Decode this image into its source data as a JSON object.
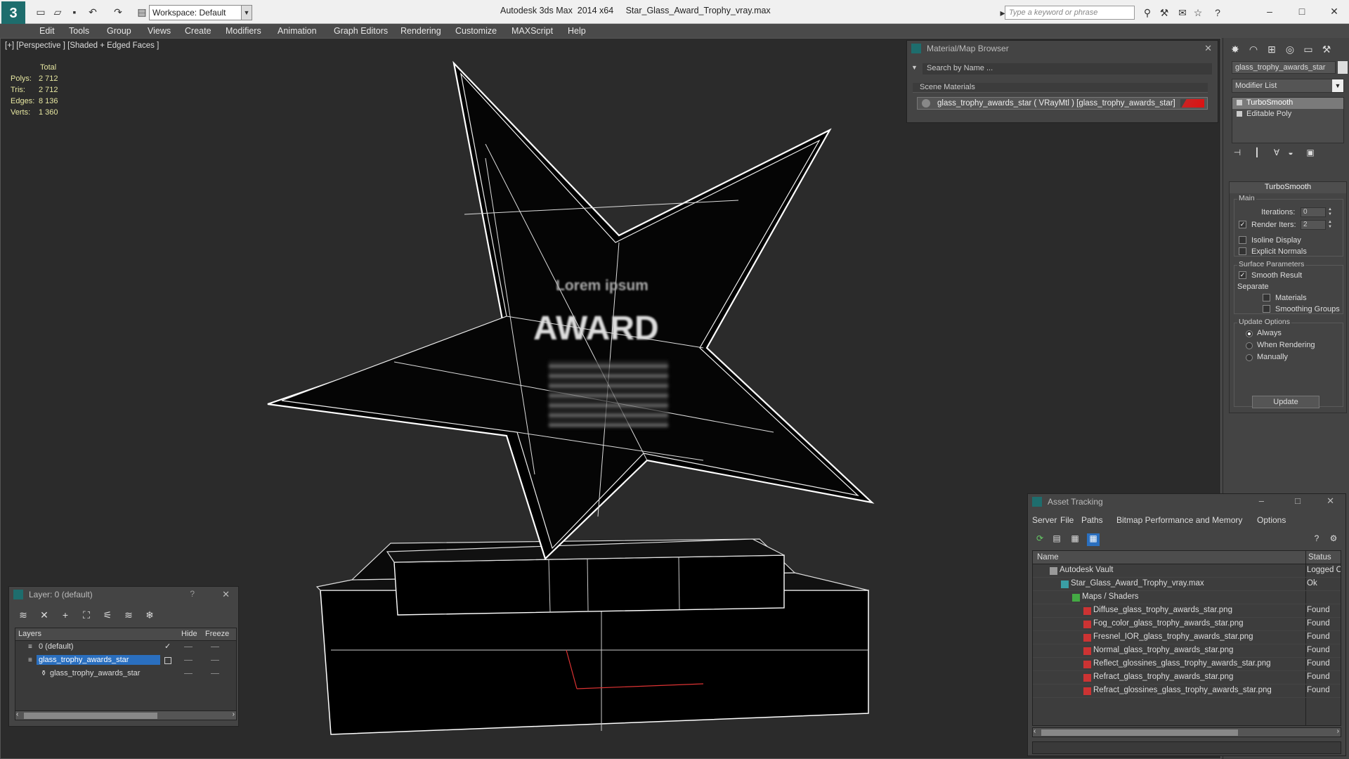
{
  "titlebar": {
    "workspace": "Workspace: Default",
    "title": "Autodesk 3ds Max  2014 x64     Star_Glass_Award_Trophy_vray.max",
    "search_placeholder": "Type a keyword or phrase"
  },
  "menu": [
    "Edit",
    "Tools",
    "Group",
    "Views",
    "Create",
    "Modifiers",
    "Animation",
    "Graph Editors",
    "Rendering",
    "Customize",
    "MAXScript",
    "Help"
  ],
  "viewport": {
    "label": "[+] [Perspective ] [Shaded + Edged Faces ]",
    "stats_header": "Total",
    "stats": [
      {
        "label": "Polys:",
        "value": "2 712"
      },
      {
        "label": "Tris:",
        "value": "2 712"
      },
      {
        "label": "Edges:",
        "value": "8 136"
      },
      {
        "label": "Verts:",
        "value": "1 360"
      }
    ],
    "award_top": "Lorem ipsum",
    "award_main": "AWARD"
  },
  "material_browser": {
    "title": "Material/Map Browser",
    "search": "Search by Name ...",
    "group": "Scene Materials",
    "entry": "glass_trophy_awards_star ( VRayMtl ) [glass_trophy_awards_star]",
    "swatch_color": "#cc1111"
  },
  "command_panel": {
    "object_name": "glass_trophy_awards_star",
    "modifier_list": "Modifier List",
    "stack": [
      "TurboSmooth",
      "Editable Poly"
    ],
    "rollout_title": "TurboSmooth",
    "main_group": "Main",
    "iterations_label": "Iterations:",
    "iterations_value": "0",
    "render_iters_label": "Render Iters:",
    "render_iters_value": "2",
    "isoline": "Isoline Display",
    "explicit_normals": "Explicit Normals",
    "surface_group": "Surface Parameters",
    "smooth_result": "Smooth Result",
    "separate": "Separate",
    "materials": "Materials",
    "smoothing_groups": "Smoothing Groups",
    "update_group": "Update Options",
    "always": "Always",
    "when_rendering": "When Rendering",
    "manually": "Manually",
    "update_button": "Update"
  },
  "layer_panel": {
    "title": "Layer: 0 (default)",
    "help": "?",
    "col_layers": "Layers",
    "col_hide": "Hide",
    "col_freeze": "Freeze",
    "rows": [
      {
        "name": "0 (default)"
      },
      {
        "name": "glass_trophy_awards_star"
      },
      {
        "name": "glass_trophy_awards_star"
      }
    ]
  },
  "asset_tracking": {
    "title": "Asset Tracking",
    "menu": [
      "Server",
      "File",
      "Paths",
      "Bitmap Performance and Memory",
      "Options"
    ],
    "col_name": "Name",
    "col_status": "Status",
    "rows": [
      {
        "name": "Autodesk Vault",
        "status": "Logged Out"
      },
      {
        "name": "Star_Glass_Award_Trophy_vray.max",
        "status": "Ok"
      },
      {
        "name": "Maps / Shaders",
        "status": ""
      },
      {
        "name": "Diffuse_glass_trophy_awards_star.png",
        "status": "Found"
      },
      {
        "name": "Fog_color_glass_trophy_awards_star.png",
        "status": "Found"
      },
      {
        "name": "Fresnel_IOR_glass_trophy_awards_star.png",
        "status": "Found"
      },
      {
        "name": "Normal_glass_trophy_awards_star.png",
        "status": "Found"
      },
      {
        "name": "Reflect_glossines_glass_trophy_awards_star.png",
        "status": "Found"
      },
      {
        "name": "Refract_glass_trophy_awards_star.png",
        "status": "Found"
      },
      {
        "name": "Refract_glossines_glass_trophy_awards_star.png",
        "status": "Found"
      }
    ]
  }
}
